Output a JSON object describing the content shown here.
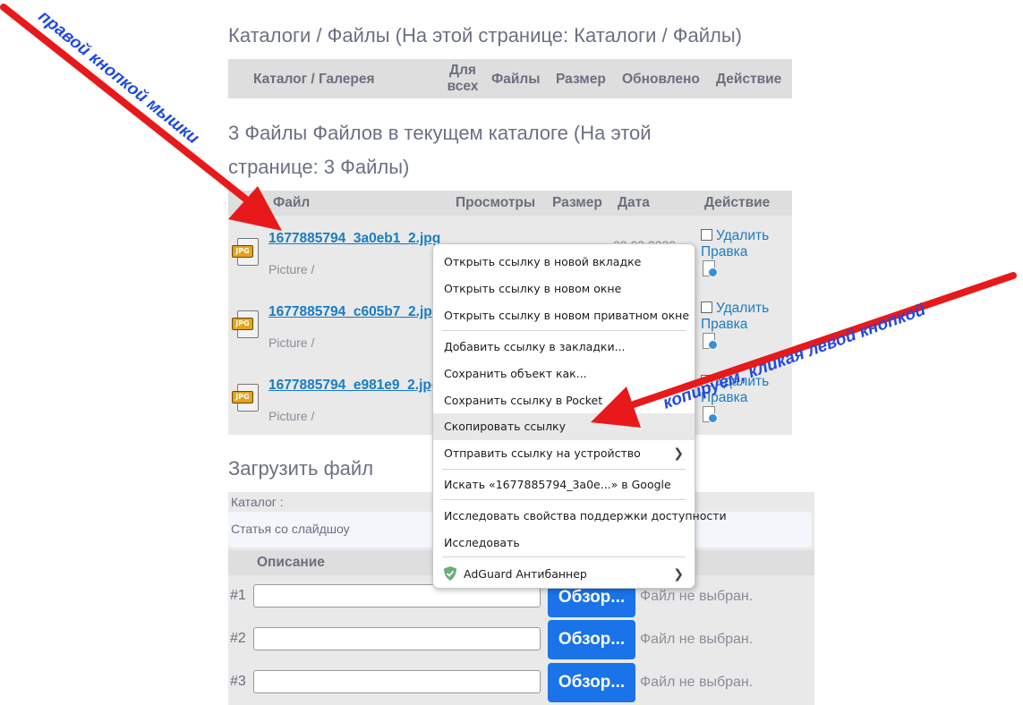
{
  "catalogs": {
    "title": "Каталоги / Файлы (На этой странице: Каталоги / Файлы)",
    "columns": [
      "Каталог / Галерея",
      "Для всех",
      "Файлы",
      "Размер",
      "Обновлено",
      "Действие"
    ]
  },
  "files": {
    "title": "3 Файлы Файлов в текущем каталоге (На этой странице: 3 Файлы)",
    "columns": [
      "Файл",
      "Просмотры",
      "Размер",
      "Дата",
      "Действие"
    ],
    "icon": "jpg-file-icon",
    "icon_label": "JPG",
    "rows": [
      {
        "name": "1677885794_3a0eb1_2.jpg",
        "meta": "Picture /",
        "date": "02.03.2023",
        "delete": "Удалить",
        "edit": "Правка"
      },
      {
        "name": "1677885794_c605b7_2.jp",
        "meta": "Picture /",
        "date": "",
        "delete": "Удалить",
        "edit": "Правка"
      },
      {
        "name": "1677885794_e981e9_2.jpg",
        "meta": "Picture /",
        "date": "",
        "delete": "Удалить",
        "edit": "Правка"
      }
    ]
  },
  "upload": {
    "title": "Загрузить файл",
    "catalog_label": "Каталог :",
    "catalog_value": "Статья со слайдшоу",
    "desc_header": "Описание",
    "rows": [
      {
        "num": "#1",
        "browse": "Обзор...",
        "status": "Файл не выбран."
      },
      {
        "num": "#2",
        "browse": "Обзор...",
        "status": "Файл не выбран."
      },
      {
        "num": "#3",
        "browse": "Обзор...",
        "status": "Файл не выбран."
      }
    ]
  },
  "context_menu": {
    "items": [
      "Открыть ссылку в новой вкладке",
      "Открыть ссылку в новом окне",
      "Открыть ссылку в новом приватном окне",
      "Добавить ссылку в закладки...",
      "Сохранить объект как...",
      "Сохранить ссылку в Pocket",
      "Скопировать ссылку",
      "Отправить ссылку на устройство",
      "Искать «1677885794_3a0e...» в Google",
      "Исследовать свойства поддержки доступности",
      "Исследовать",
      "AdGuard Антибаннер"
    ],
    "highlighted": "Скопировать ссылку"
  },
  "annotations": {
    "right_click": "правой кнопкой мышки",
    "copy_left_click": "копируем, кликая левой кнопкой",
    "arrow_color": "#e8191a",
    "text_color": "#2149e0"
  },
  "colors": {
    "link": "#1a7cc1",
    "header_bg": "#dedede",
    "panel_bg": "#e9e9e9",
    "browse_button": "#1a73e8"
  }
}
